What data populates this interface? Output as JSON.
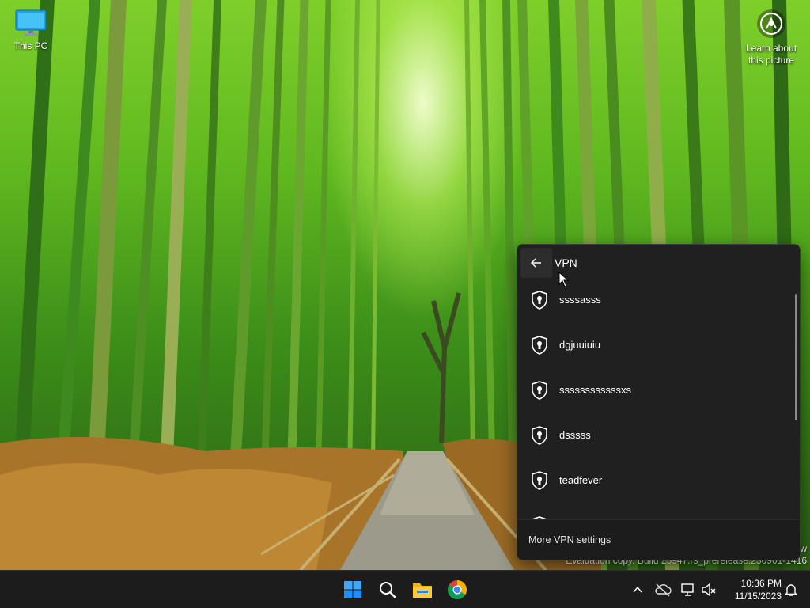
{
  "desktop": {
    "icons": [
      {
        "label": "This PC",
        "icon": "this-pc-icon"
      }
    ],
    "learn_picture": {
      "line1": "Learn about",
      "line2": "this picture",
      "icon": "camera-aperture-icon"
    },
    "watermark": {
      "line1": "w",
      "line2": "Evaluation copy. Build 25947.rs_prerelease.230901-1416"
    }
  },
  "vpn_flyout": {
    "title": "VPN",
    "back_icon": "back-arrow-icon",
    "connections": [
      {
        "name": "ssssasss",
        "icon": "vpn-shield-icon"
      },
      {
        "name": "dgjuuiuiu",
        "icon": "vpn-shield-icon"
      },
      {
        "name": "ssssssssssssxs",
        "icon": "vpn-shield-icon"
      },
      {
        "name": "dsssss",
        "icon": "vpn-shield-icon"
      },
      {
        "name": "teadfever",
        "icon": "vpn-shield-icon"
      },
      {
        "name": "",
        "icon": "vpn-shield-icon"
      }
    ],
    "more_settings": "More VPN settings"
  },
  "taskbar": {
    "apps": [
      {
        "name": "Start",
        "icon": "windows-start-icon"
      },
      {
        "name": "Search",
        "icon": "search-icon"
      },
      {
        "name": "File Explorer",
        "icon": "folder-icon"
      },
      {
        "name": "Google Chrome",
        "icon": "chrome-icon"
      }
    ],
    "tray": [
      {
        "name": "Show hidden icons",
        "icon": "chevron-up-icon"
      },
      {
        "name": "OneDrive",
        "icon": "cloud-offline-icon"
      },
      {
        "name": "Network",
        "icon": "network-icon"
      },
      {
        "name": "Volume",
        "icon": "speaker-muted-icon"
      }
    ],
    "clock": {
      "time": "10:36 PM",
      "date": "11/15/2023"
    },
    "notifications_icon": "bell-icon"
  },
  "colors": {
    "flyout_bg": "#202020",
    "taskbar_bg": "#1c1c1c",
    "windows_blue": "#1e90ff"
  }
}
